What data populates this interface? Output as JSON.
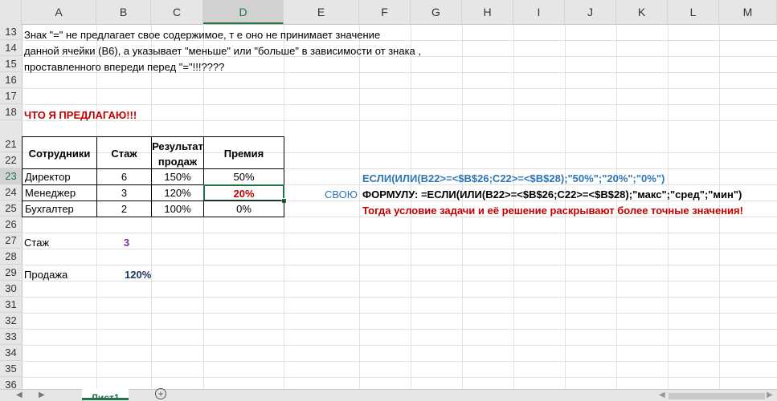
{
  "columns": [
    "A",
    "B",
    "C",
    "D",
    "E",
    "F",
    "G",
    "H",
    "I",
    "J",
    "K",
    "L",
    "M"
  ],
  "rows": [
    "13",
    "14",
    "15",
    "16",
    "17",
    "18",
    "21",
    "22",
    "23",
    "24",
    "25",
    "26",
    "27",
    "28",
    "29",
    "30",
    "31",
    "32",
    "33",
    "34",
    "35",
    "36"
  ],
  "text": {
    "r13": "Знак \"=\" не предлагает свое содержимое, т е оно не принимает значение",
    "r14": "данной ячейки (В6), а указывает \"меньше\" или \"больше\" в зависимости от знака ,",
    "r15": "проставленного впереди перед \"=\"!!!????",
    "r18": "ЧТО Я ПРЕДЛАГАЮ!!!"
  },
  "table": {
    "headers": [
      "Сотрудники",
      "Стаж",
      "Результат",
      "продаж",
      "Премия"
    ],
    "rows": [
      [
        "Директор",
        "6",
        "150%",
        "50%"
      ],
      [
        "Менеджер",
        "3",
        "120%",
        "20%"
      ],
      [
        "Бухгалтер",
        "2",
        "100%",
        "0%"
      ]
    ]
  },
  "formulas": {
    "f22": "ЕСЛИ(ИЛИ(B22>=<$B$26;C22>=<$B$28);\"50%\";\"20%\";\"0%\")",
    "e23": "СВОЮ",
    "f23": "ФОРМУЛУ: =ЕСЛИ(ИЛИ(B22>=<$B$26;C22>=<$B$28);\"макс\";\"сред\";\"мин\")",
    "f24": "Тогда условие задачи и её решение раскрывают более точные значения!"
  },
  "params": {
    "stazh_label": "Стаж",
    "stazh_value": "3",
    "prodazha_label": "Продажа",
    "prodazha_value": "120%"
  },
  "sheet_tab": "Лист1",
  "colors": {
    "accent_green": "#217346",
    "red": "#c00000",
    "blue": "#2e75b6",
    "purple": "#7030a0",
    "navy": "#1f3864"
  }
}
